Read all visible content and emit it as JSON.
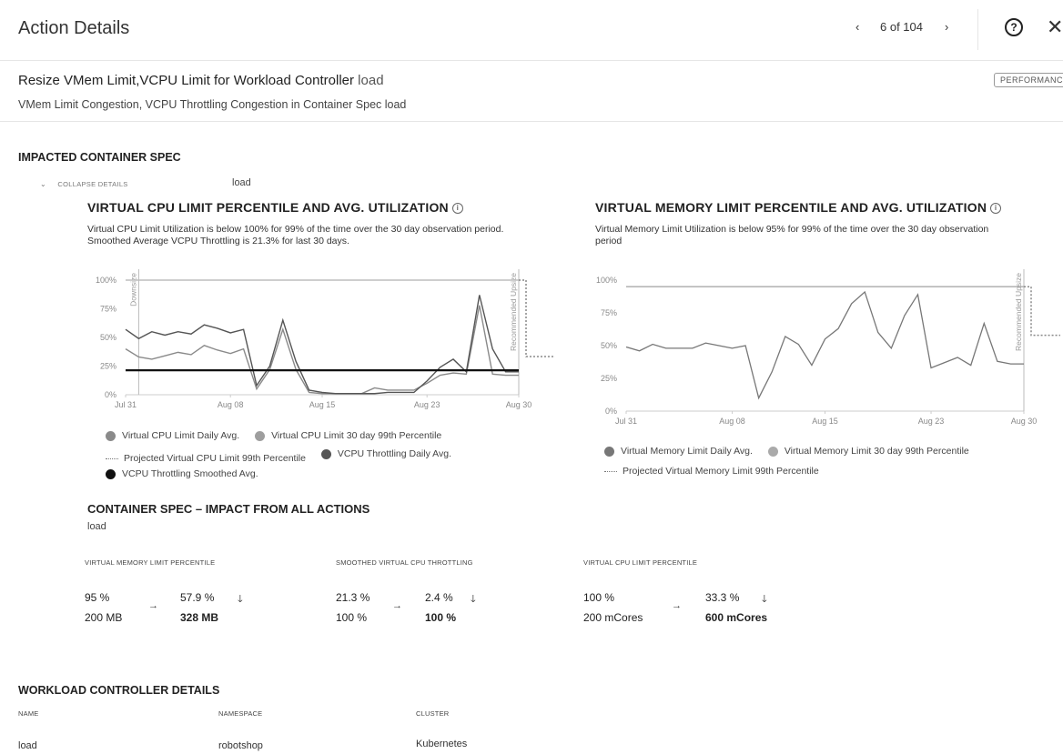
{
  "header": {
    "title": "Action Details",
    "pager": {
      "prev": "‹",
      "text": "6 of 104",
      "next": "›"
    },
    "help": "?",
    "close": "✕"
  },
  "action": {
    "title": "Resize VMem Limit,VCPU Limit for Workload Controller",
    "title_suffix": "load",
    "description": "VMem Limit Congestion, VCPU Throttling Congestion in Container Spec load",
    "badge": "PERFORMANCE"
  },
  "impacted": {
    "heading": "IMPACTED CONTAINER SPEC",
    "collapse_label": "COLLAPSE DETAILS",
    "spec_name": "load"
  },
  "cpu_chart": {
    "title": "VIRTUAL CPU LIMIT PERCENTILE AND AVG. UTILIZATION",
    "desc1": "Virtual CPU Limit Utilization is below 100% for 99% of the time over the 30 day observation period.",
    "desc2": "Smoothed Average VCPU Throttling is 21.3% for last 30 days.",
    "downsize_label": "Downsize",
    "upsize_label": "Recommended Upsize",
    "legend": [
      "Virtual CPU Limit Daily Avg.",
      "Virtual CPU Limit 30 day 99th Percentile",
      "Projected Virtual CPU Limit 99th Percentile",
      "VCPU Throttling Daily Avg.",
      "VCPU Throttling Smoothed Avg."
    ]
  },
  "mem_chart": {
    "title": "VIRTUAL MEMORY LIMIT PERCENTILE AND AVG. UTILIZATION",
    "desc1": "Virtual Memory Limit Utilization is below 95% for 99% of the time over the 30 day observation",
    "desc2": "period",
    "upsize_label": "Recommended Upsize",
    "legend": [
      "Virtual Memory Limit Daily Avg.",
      "Virtual Memory Limit 30 day 99th Percentile",
      "Projected Virtual Memory Limit 99th Percentile"
    ]
  },
  "chart_data": [
    {
      "type": "line",
      "title": "VIRTUAL CPU LIMIT PERCENTILE AND AVG. UTILIZATION",
      "x": [
        "Jul 31",
        "Aug 01",
        "Aug 02",
        "Aug 03",
        "Aug 04",
        "Aug 05",
        "Aug 06",
        "Aug 07",
        "Aug 08",
        "Aug 09",
        "Aug 10",
        "Aug 11",
        "Aug 12",
        "Aug 13",
        "Aug 14",
        "Aug 15",
        "Aug 16",
        "Aug 17",
        "Aug 18",
        "Aug 19",
        "Aug 20",
        "Aug 21",
        "Aug 22",
        "Aug 23",
        "Aug 24",
        "Aug 25",
        "Aug 26",
        "Aug 27",
        "Aug 28",
        "Aug 29",
        "Aug 30"
      ],
      "xticks": [
        "Jul 31",
        "Aug 08",
        "Aug 15",
        "Aug 23",
        "Aug 30"
      ],
      "yticks": [
        "0%",
        "25%",
        "50%",
        "75%",
        "100%"
      ],
      "ylim": [
        0,
        100
      ],
      "series": [
        {
          "name": "Virtual CPU Limit Daily Avg.",
          "color": "#8a8a8a",
          "values": [
            40,
            33,
            31,
            34,
            37,
            35,
            43,
            39,
            36,
            40,
            5,
            22,
            57,
            22,
            2,
            1,
            1,
            1,
            1,
            6,
            4,
            4,
            4,
            10,
            17,
            19,
            18,
            78,
            18,
            17,
            17
          ]
        },
        {
          "name": "Virtual CPU Limit 30 day 99th Percentile",
          "color": "#bdbdbd",
          "values": [
            100,
            100,
            100,
            100,
            100,
            100,
            100,
            100,
            100,
            100,
            100,
            100,
            100,
            100,
            100,
            100,
            100,
            100,
            100,
            100,
            100,
            100,
            100,
            100,
            100,
            100,
            100,
            100,
            100,
            100,
            100
          ]
        },
        {
          "name": "VCPU Throttling Daily Avg.",
          "color": "#555555",
          "values": [
            57,
            49,
            55,
            52,
            55,
            53,
            61,
            58,
            54,
            57,
            8,
            25,
            65,
            29,
            4,
            2,
            1,
            1,
            1,
            1,
            2,
            2,
            2,
            12,
            24,
            31,
            20,
            87,
            40,
            20,
            20
          ]
        },
        {
          "name": "VCPU Throttling Smoothed Avg.",
          "color": "#111111",
          "values": [
            21.3,
            21.3,
            21.3,
            21.3,
            21.3,
            21.3,
            21.3,
            21.3,
            21.3,
            21.3,
            21.3,
            21.3,
            21.3,
            21.3,
            21.3,
            21.3,
            21.3,
            21.3,
            21.3,
            21.3,
            21.3,
            21.3,
            21.3,
            21.3,
            21.3,
            21.3,
            21.3,
            21.3,
            21.3,
            21.3,
            21.3
          ]
        },
        {
          "name": "Projected Virtual CPU Limit 99th Percentile",
          "color": "#888888",
          "values": [
            33.3,
            33.3
          ]
        }
      ]
    },
    {
      "type": "line",
      "title": "VIRTUAL MEMORY LIMIT PERCENTILE AND AVG. UTILIZATION",
      "x": [
        "Jul 31",
        "Aug 01",
        "Aug 02",
        "Aug 03",
        "Aug 04",
        "Aug 05",
        "Aug 06",
        "Aug 07",
        "Aug 08",
        "Aug 09",
        "Aug 10",
        "Aug 11",
        "Aug 12",
        "Aug 13",
        "Aug 14",
        "Aug 15",
        "Aug 16",
        "Aug 17",
        "Aug 18",
        "Aug 19",
        "Aug 20",
        "Aug 21",
        "Aug 22",
        "Aug 23",
        "Aug 24",
        "Aug 25",
        "Aug 26",
        "Aug 27",
        "Aug 28",
        "Aug 29",
        "Aug 30"
      ],
      "xticks": [
        "Jul 31",
        "Aug 08",
        "Aug 15",
        "Aug 23",
        "Aug 30"
      ],
      "yticks": [
        "0%",
        "25%",
        "50%",
        "75%",
        "100%"
      ],
      "ylim": [
        0,
        100
      ],
      "series": [
        {
          "name": "Virtual Memory Limit Daily Avg.",
          "color": "#777777",
          "values": [
            49,
            46,
            51,
            48,
            48,
            48,
            52,
            50,
            48,
            50,
            10,
            30,
            57,
            51,
            35,
            55,
            63,
            82,
            91,
            60,
            48,
            73,
            89,
            33,
            37,
            41,
            35,
            67,
            38,
            36,
            36
          ]
        },
        {
          "name": "Virtual Memory Limit 30 day 99th Percentile",
          "color": "#aaaaaa",
          "values": [
            95,
            95,
            95,
            95,
            95,
            95,
            95,
            95,
            95,
            95,
            95,
            95,
            95,
            95,
            95,
            95,
            95,
            95,
            95,
            95,
            95,
            95,
            95,
            95,
            95,
            95,
            95,
            95,
            95,
            95,
            95
          ]
        },
        {
          "name": "Projected Virtual Memory Limit 99th Percentile",
          "color": "#888888",
          "values": [
            57.9,
            57.9
          ]
        }
      ]
    }
  ],
  "impact": {
    "heading": "CONTAINER SPEC – IMPACT FROM ALL ACTIONS",
    "subheading": "load",
    "cols": [
      {
        "label": "VIRTUAL MEMORY LIMIT PERCENTILE",
        "from1": "95 %",
        "from2": "200 MB",
        "to1": "57.9 %",
        "to2": "328 MB"
      },
      {
        "label": "SMOOTHED VIRTUAL CPU THROTTLING",
        "from1": "21.3 %",
        "from2": "100 %",
        "to1": "2.4 %",
        "to2": "100 %"
      },
      {
        "label": "VIRTUAL CPU LIMIT PERCENTILE",
        "from1": "100 %",
        "from2": "200 mCores",
        "to1": "33.3 %",
        "to2": "600 mCores"
      }
    ],
    "arrow": "→",
    "down": "🡓"
  },
  "workload": {
    "heading": "WORKLOAD CONTROLLER DETAILS",
    "headers": [
      "NAME",
      "NAMESPACE",
      "CLUSTER"
    ],
    "values": [
      "load",
      "robotshop",
      "Kubernetes"
    ]
  }
}
